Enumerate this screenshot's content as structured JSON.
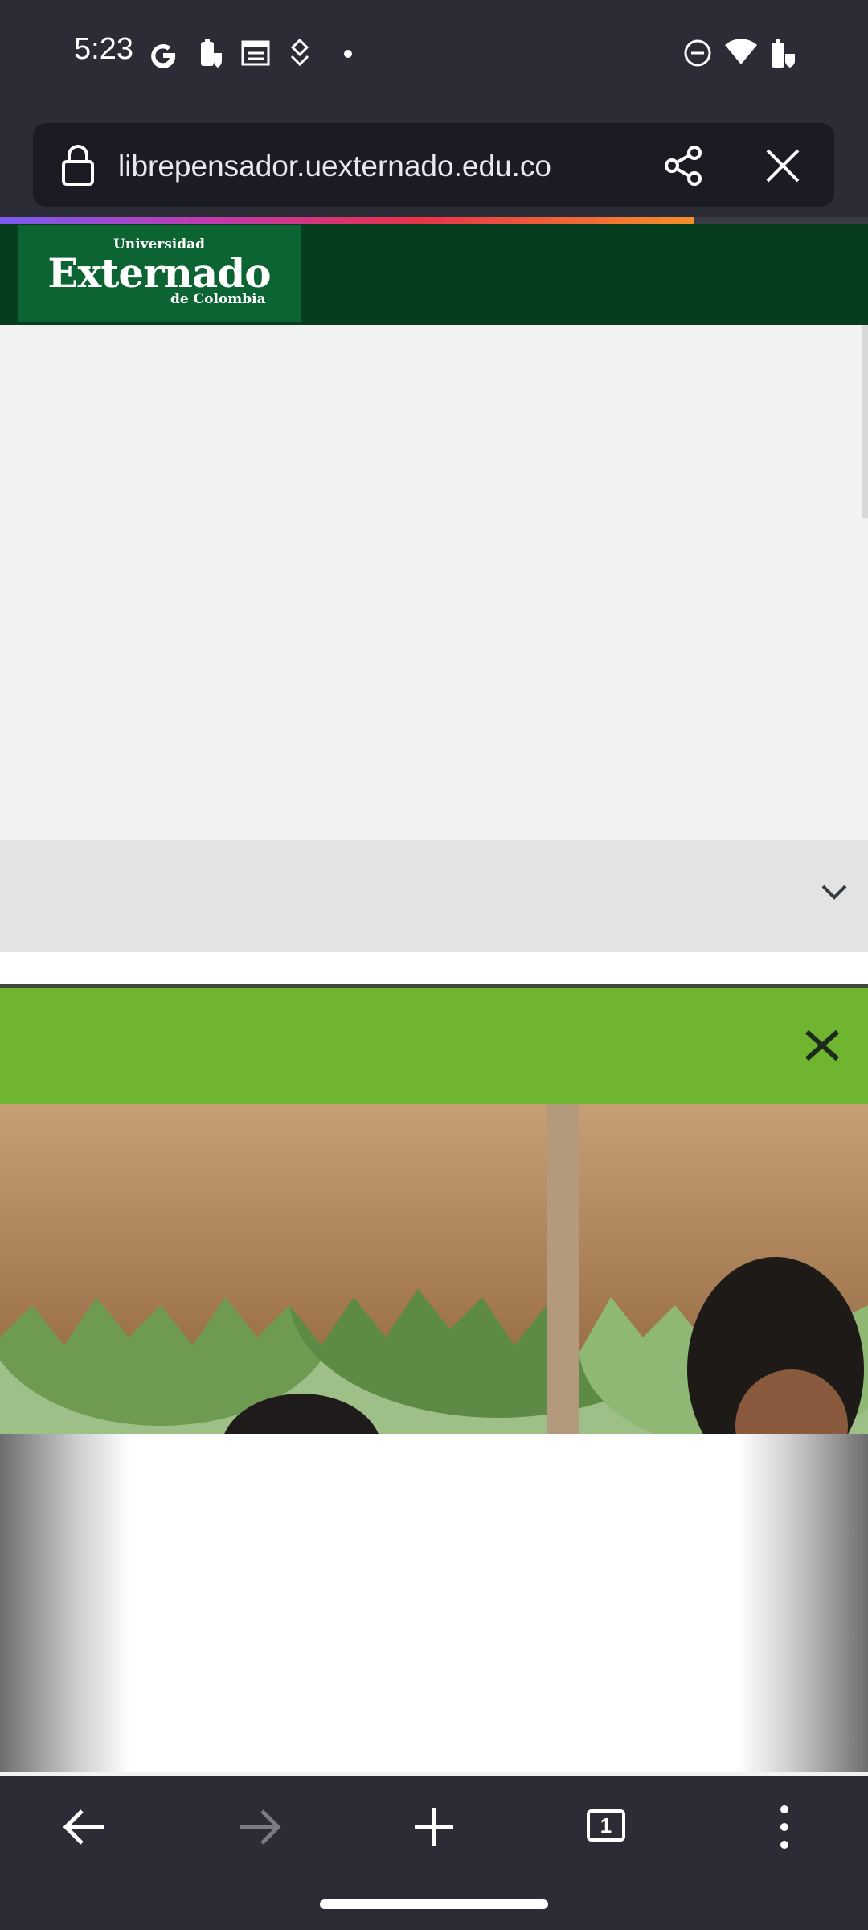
{
  "status_bar": {
    "time": "5:23",
    "left_icons": [
      "google-icon",
      "battery-saver-icon",
      "calendar-icon",
      "download-icon",
      "dot-icon"
    ],
    "right_icons": [
      "do-not-disturb-icon",
      "wifi-icon",
      "battery-icon"
    ]
  },
  "browser": {
    "url": "librepensador.uexternado.edu.co",
    "load_progress": 0.8,
    "gradient_colors": [
      "#7a5cf0",
      "#c13ab0",
      "#e8324a",
      "#f5902a"
    ]
  },
  "site": {
    "logo_top": "Universidad",
    "logo_main": "Externado",
    "logo_bottom": "de Colombia",
    "header_color": "#063d1f",
    "logo_color": "#0b6431",
    "popup_bar_color": "#6fb52f"
  },
  "toolbar": {
    "tab_count": "1"
  }
}
